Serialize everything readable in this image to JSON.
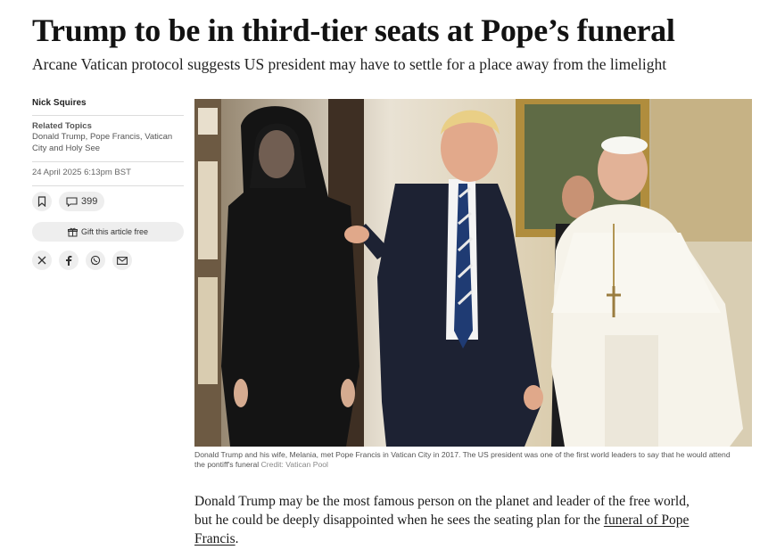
{
  "article": {
    "headline": "Trump to be in third-tier seats at Pope’s funeral",
    "standfirst": "Arcane Vatican protocol suggests US president may have to settle for a place away from the limelight"
  },
  "sidebar": {
    "author": "Nick Squires",
    "related_topics_title": "Related Topics",
    "related_topics": "Donald Trump, Pope Francis, Vatican City and Holy See",
    "date": "24 April 2025 6:13pm BST",
    "comment_count": "399",
    "gift_label": "Gift this article free",
    "icons": {
      "bookmark": "bookmark-icon",
      "comments": "speech-bubble-icon",
      "gift": "gift-icon",
      "share": [
        "x-icon",
        "facebook-icon",
        "whatsapp-icon",
        "email-icon"
      ]
    }
  },
  "image": {
    "caption": "Donald Trump and his wife, Melania, met Pope Francis in Vatican City in 2017. The US president was one of the first world leaders to say that he would attend the pontiff's funeral",
    "credit": "Credit: Vatican Pool"
  },
  "body": {
    "text_before": "Donald Trump may be the most famous person on the planet and leader of the free world, but he could be deeply disappointed when he sees the seating plan for the ",
    "link_text": "funeral of Pope Francis",
    "text_after": "."
  },
  "colors": {
    "text": "#121212",
    "button_bg": "#eeeeee",
    "rule": "#dcdcdc"
  }
}
